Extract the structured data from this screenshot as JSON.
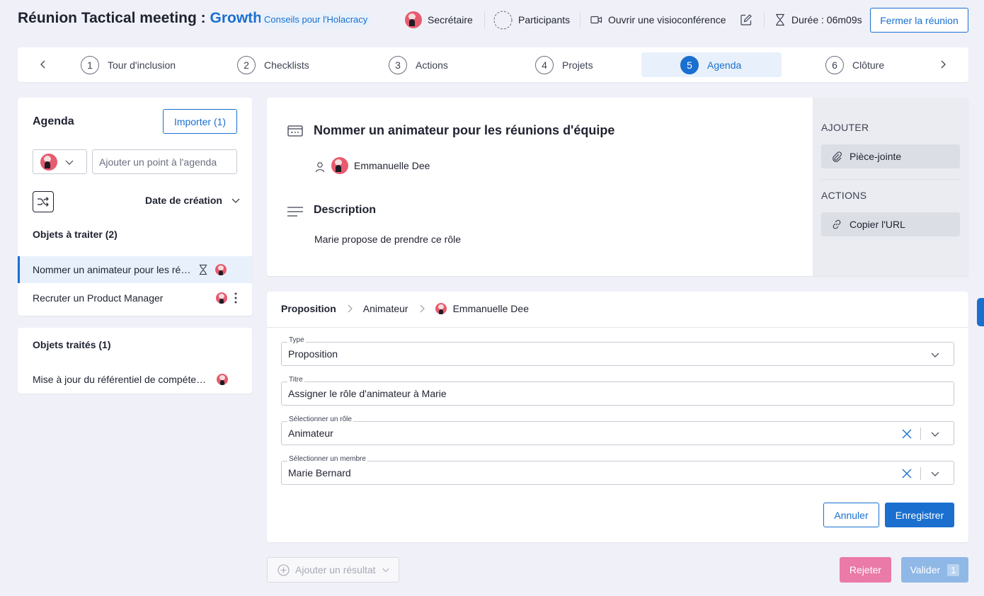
{
  "header": {
    "title_prefix": "Réunion Tactical meeting : ",
    "circle": "Growth",
    "tag": "Conseils pour l'Holacracy",
    "secretary": "Secrétaire",
    "participants": "Participants",
    "video": "Ouvrir une visioconférence",
    "duration": "Durée : 06m09s",
    "close_button": "Fermer la réunion"
  },
  "steps": [
    {
      "num": "1",
      "label": "Tour d'inclusion"
    },
    {
      "num": "2",
      "label": "Checklists"
    },
    {
      "num": "3",
      "label": "Actions"
    },
    {
      "num": "4",
      "label": "Projets"
    },
    {
      "num": "5",
      "label": "Agenda"
    },
    {
      "num": "6",
      "label": "Clôture"
    }
  ],
  "agenda": {
    "title": "Agenda",
    "import_button": "Importer (1)",
    "add_placeholder": "Ajouter un point à l'agenda",
    "sort_label": "Date de création",
    "to_process_title": "Objets à traiter (2)",
    "to_process": [
      {
        "label": "Nommer un animateur pour les réunions d'équipe"
      },
      {
        "label": "Recruter un Product Manager"
      }
    ],
    "processed_title": "Objets traités (1)",
    "processed": [
      {
        "label": "Mise à jour du référentiel de compétences"
      }
    ]
  },
  "item": {
    "title": "Nommer un animateur pour les réunions d'équipe",
    "owner": "Emmanuelle Dee",
    "description_title": "Description",
    "description": "Marie propose de prendre ce rôle",
    "add_section": "AJOUTER",
    "attachment": "Pièce-jointe",
    "actions_section": "ACTIONS",
    "copy_url": "Copier l'URL"
  },
  "proposal": {
    "crumb1": "Proposition",
    "crumb2": "Animateur",
    "crumb3": "Emmanuelle Dee",
    "type_label": "Type",
    "type_value": "Proposition",
    "title_label": "Titre",
    "title_value": "Assigner le rôle d'animateur à Marie",
    "role_label": "Sélectionner un rôle",
    "role_value": "Animateur",
    "member_label": "Sélectionner un membre",
    "member_value": "Marie Bernard",
    "cancel": "Annuler",
    "save": "Enregistrer"
  },
  "footer": {
    "add_result": "Ajouter un résultat",
    "reject": "Rejeter",
    "validate": "Valider",
    "validate_count": "1"
  },
  "colors": {
    "accent": "#1a6fcf",
    "reject": "#ea7aa8",
    "validate": "#8fb8e6"
  }
}
